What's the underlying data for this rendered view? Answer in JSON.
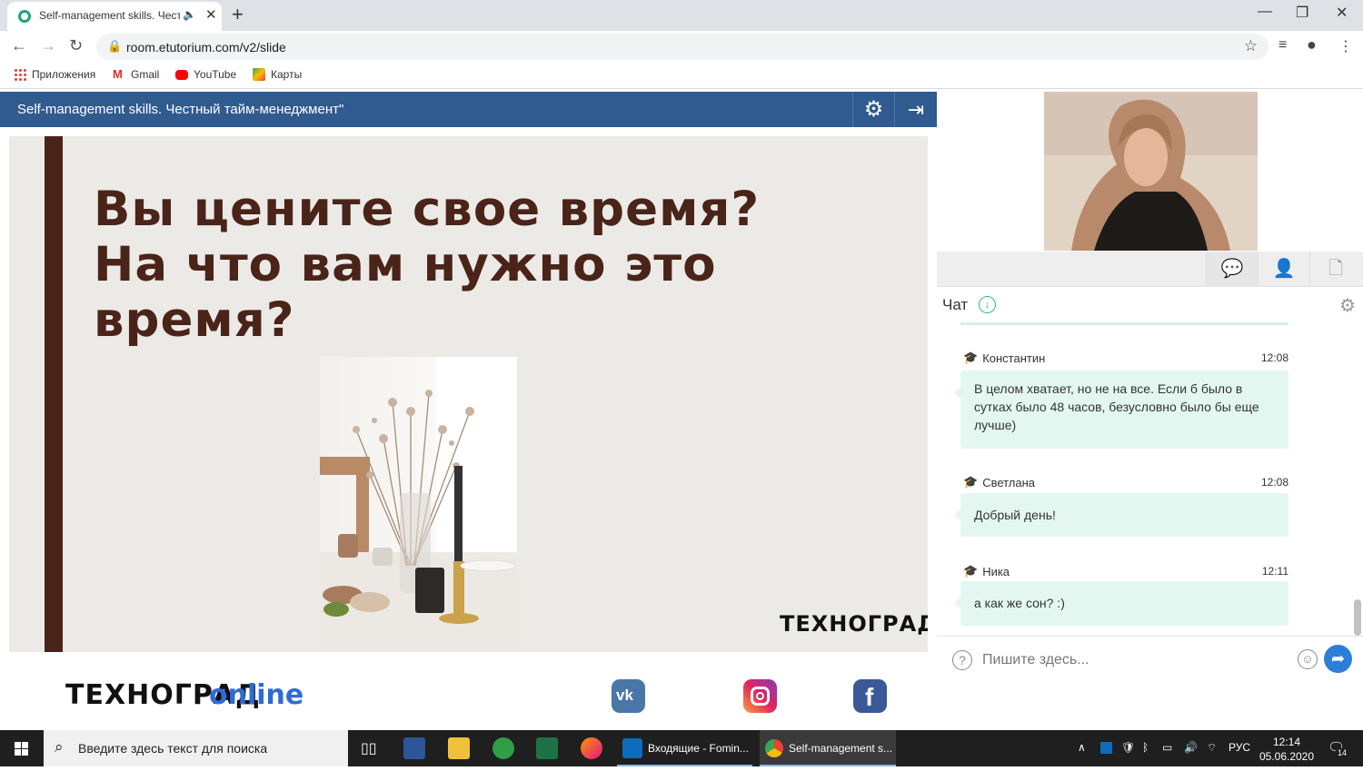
{
  "browser": {
    "tab_title": "Self-management skills. Чест",
    "url": "room.etutorium.com/v2/slide",
    "new_tab": "+",
    "bookmarks": [
      "Приложения",
      "Gmail",
      "YouTube",
      "Карты"
    ]
  },
  "app": {
    "title": "Self-management skills. Честный тайм-менеджмент\""
  },
  "slide": {
    "line1": "Вы цените свое время?",
    "line2": "На что вам нужно это",
    "line3": "время?",
    "logo": "ТЕХНОГРАД"
  },
  "footer": {
    "logo_main": "ТЕХНОГРАД",
    "logo_online": "online"
  },
  "chat": {
    "title": "Чат",
    "messages": [
      {
        "author": "Константин",
        "time": "12:08",
        "text": "В целом хватает, но не на все. Если б было в сутках было 48 часов, безусловно было бы еще лучше)"
      },
      {
        "author": "Светлана",
        "time": "12:08",
        "text": "Добрый день!"
      },
      {
        "author": "Ника",
        "time": "12:11",
        "text": "а как же сон? :)"
      }
    ],
    "input_placeholder": "Пишите здесь..."
  },
  "taskbar": {
    "search_placeholder": "Введите здесь текст для поиска",
    "apps": [
      {
        "label": "Входящие - Fomin..."
      },
      {
        "label": "Self-management s..."
      }
    ],
    "lang": "РУС",
    "time": "12:14",
    "date": "05.06.2020",
    "notifications": "14"
  },
  "colors": {
    "header_blue": "#2f5b8f",
    "slide_brown": "#4a2418",
    "bubble_green": "#e3f7f0",
    "send_blue": "#2b7fd6"
  }
}
